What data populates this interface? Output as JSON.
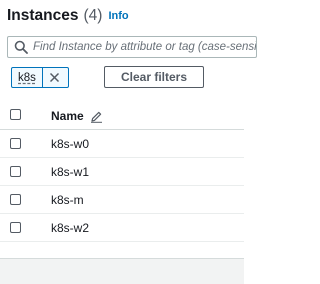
{
  "header": {
    "title": "Instances",
    "count": "(4)",
    "info_label": "Info"
  },
  "search": {
    "placeholder": "Find Instance by attribute or tag (case-sensitive)",
    "icon": "search-icon"
  },
  "filter_token": {
    "label": "k8s",
    "remove_icon": "close-icon"
  },
  "clear_filters_label": "Clear filters",
  "table": {
    "columns": [
      "Name"
    ],
    "rows": [
      {
        "name": "k8s-w0"
      },
      {
        "name": "k8s-w1"
      },
      {
        "name": "k8s-m"
      },
      {
        "name": "k8s-w2"
      }
    ]
  },
  "colors": {
    "link": "#0073bb",
    "text": "#16191f",
    "secondary_text": "#545b64"
  }
}
